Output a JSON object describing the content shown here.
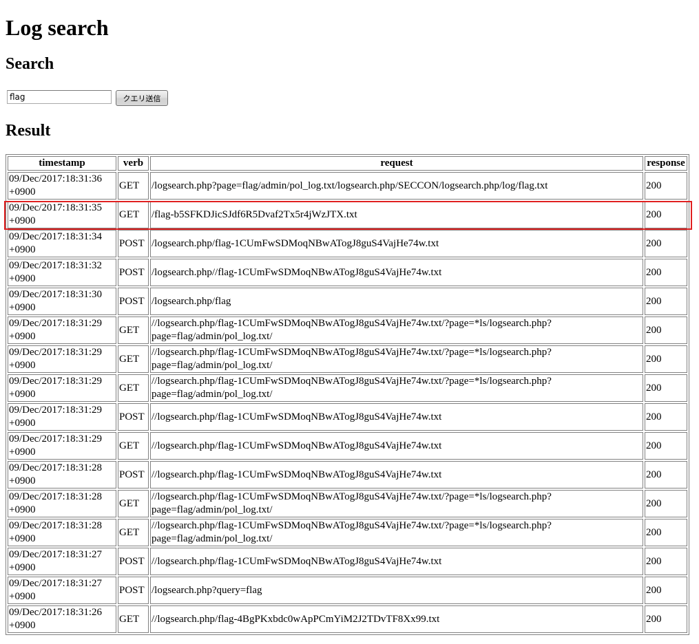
{
  "page": {
    "title": "Log search",
    "search_heading": "Search",
    "result_heading": "Result"
  },
  "search": {
    "query_value": "flag",
    "submit_label": "クエリ送信"
  },
  "table": {
    "headers": {
      "timestamp": "timestamp",
      "verb": "verb",
      "request": "request",
      "response": "response"
    },
    "rows": [
      {
        "timestamp": "09/Dec/2017:18:31:36 +0900",
        "verb": "GET",
        "request": "/logsearch.php?page=flag/admin/pol_log.txt/logsearch.php/SECCON/logsearch.php/log/flag.txt",
        "response": "200"
      },
      {
        "timestamp": "09/Dec/2017:18:31:35 +0900",
        "verb": "GET",
        "request": "/flag-b5SFKDJicSJdf6R5Dvaf2Tx5r4jWzJTX.txt",
        "response": "200"
      },
      {
        "timestamp": "09/Dec/2017:18:31:34 +0900",
        "verb": "POST",
        "request": "/logsearch.php/flag-1CUmFwSDMoqNBwATogJ8guS4VajHe74w.txt",
        "response": "200"
      },
      {
        "timestamp": "09/Dec/2017:18:31:32 +0900",
        "verb": "POST",
        "request": "/logsearch.php//flag-1CUmFwSDMoqNBwATogJ8guS4VajHe74w.txt",
        "response": "200"
      },
      {
        "timestamp": "09/Dec/2017:18:31:30 +0900",
        "verb": "POST",
        "request": "/logsearch.php/flag",
        "response": "200"
      },
      {
        "timestamp": "09/Dec/2017:18:31:29 +0900",
        "verb": "GET",
        "request": "//logsearch.php/flag-1CUmFwSDMoqNBwATogJ8guS4VajHe74w.txt/?page=*ls/logsearch.php?page=flag/admin/pol_log.txt/",
        "response": "200"
      },
      {
        "timestamp": "09/Dec/2017:18:31:29 +0900",
        "verb": "GET",
        "request": "//logsearch.php/flag-1CUmFwSDMoqNBwATogJ8guS4VajHe74w.txt/?page=*ls/logsearch.php?page=flag/admin/pol_log.txt/",
        "response": "200"
      },
      {
        "timestamp": "09/Dec/2017:18:31:29 +0900",
        "verb": "GET",
        "request": "//logsearch.php/flag-1CUmFwSDMoqNBwATogJ8guS4VajHe74w.txt/?page=*ls/logsearch.php?page=flag/admin/pol_log.txt/",
        "response": "200"
      },
      {
        "timestamp": "09/Dec/2017:18:31:29 +0900",
        "verb": "POST",
        "request": "//logsearch.php/flag-1CUmFwSDMoqNBwATogJ8guS4VajHe74w.txt",
        "response": "200"
      },
      {
        "timestamp": "09/Dec/2017:18:31:29 +0900",
        "verb": "GET",
        "request": "//logsearch.php/flag-1CUmFwSDMoqNBwATogJ8guS4VajHe74w.txt",
        "response": "200"
      },
      {
        "timestamp": "09/Dec/2017:18:31:28 +0900",
        "verb": "POST",
        "request": "//logsearch.php/flag-1CUmFwSDMoqNBwATogJ8guS4VajHe74w.txt",
        "response": "200"
      },
      {
        "timestamp": "09/Dec/2017:18:31:28 +0900",
        "verb": "GET",
        "request": "//logsearch.php/flag-1CUmFwSDMoqNBwATogJ8guS4VajHe74w.txt/?page=*ls/logsearch.php?page=flag/admin/pol_log.txt/",
        "response": "200"
      },
      {
        "timestamp": "09/Dec/2017:18:31:28 +0900",
        "verb": "GET",
        "request": "//logsearch.php/flag-1CUmFwSDMoqNBwATogJ8guS4VajHe74w.txt/?page=*ls/logsearch.php?page=flag/admin/pol_log.txt/",
        "response": "200"
      },
      {
        "timestamp": "09/Dec/2017:18:31:27 +0900",
        "verb": "POST",
        "request": "//logsearch.php/flag-1CUmFwSDMoqNBwATogJ8guS4VajHe74w.txt",
        "response": "200"
      },
      {
        "timestamp": "09/Dec/2017:18:31:27 +0900",
        "verb": "POST",
        "request": "/logsearch.php?query=flag",
        "response": "200"
      },
      {
        "timestamp": "09/Dec/2017:18:31:26 +0900",
        "verb": "GET",
        "request": "//logsearch.php/flag-4BgPKxbdc0wApPCmYiM2J2TDvTF8Xx99.txt",
        "response": "200"
      }
    ]
  },
  "colors": {
    "highlight_border": "#e02020",
    "cell_border": "#808080"
  }
}
